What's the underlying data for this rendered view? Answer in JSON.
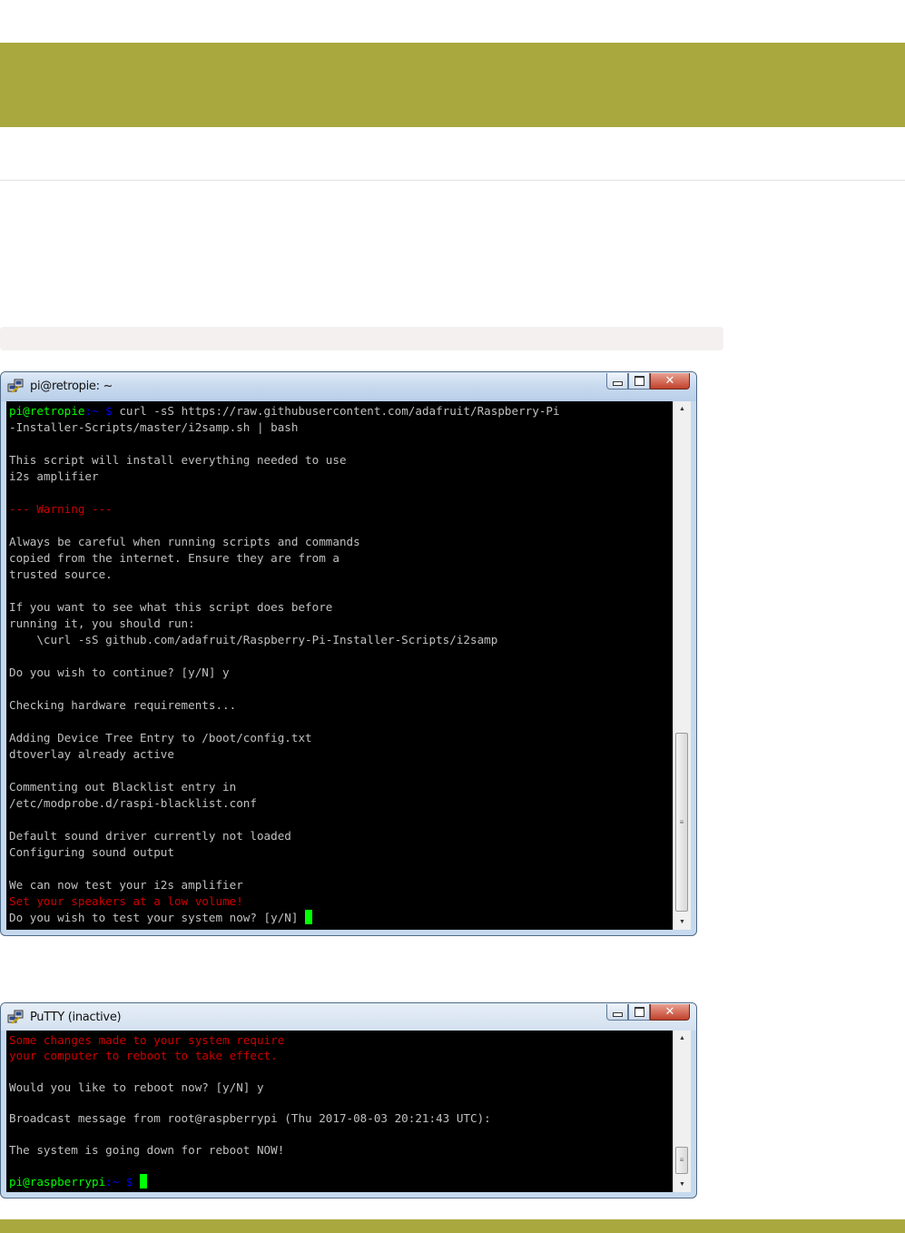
{
  "window1": {
    "title": "pi@retropie: ~",
    "lines": [
      [
        {
          "t": "pi@retropie",
          "c": "g"
        },
        {
          "t": ":~ $ ",
          "c": "b"
        },
        {
          "t": "curl -sS https://raw.githubusercontent.com/adafruit/Raspberry-Pi"
        }
      ],
      [
        {
          "t": "-Installer-Scripts/master/i2samp.sh | bash"
        }
      ],
      [],
      [
        {
          "t": "This script will install everything needed to use"
        }
      ],
      [
        {
          "t": "i2s amplifier"
        }
      ],
      [],
      [
        {
          "t": "--- Warning ---",
          "c": "r"
        }
      ],
      [],
      [
        {
          "t": "Always be careful when running scripts and commands"
        }
      ],
      [
        {
          "t": "copied from the internet. Ensure they are from a"
        }
      ],
      [
        {
          "t": "trusted source."
        }
      ],
      [],
      [
        {
          "t": "If you want to see what this script does before"
        }
      ],
      [
        {
          "t": "running it, you should run:"
        }
      ],
      [
        {
          "t": "    \\curl -sS github.com/adafruit/Raspberry-Pi-Installer-Scripts/i2samp"
        }
      ],
      [],
      [
        {
          "t": "Do you wish to continue? [y/N] y"
        }
      ],
      [],
      [
        {
          "t": "Checking hardware requirements..."
        }
      ],
      [],
      [
        {
          "t": "Adding Device Tree Entry to /boot/config.txt"
        }
      ],
      [
        {
          "t": "dtoverlay already active"
        }
      ],
      [],
      [
        {
          "t": "Commenting out Blacklist entry in"
        }
      ],
      [
        {
          "t": "/etc/modprobe.d/raspi-blacklist.conf"
        }
      ],
      [],
      [
        {
          "t": "Default sound driver currently not loaded"
        }
      ],
      [
        {
          "t": "Configuring sound output"
        }
      ],
      [],
      [
        {
          "t": "We can now test your i2s amplifier"
        }
      ],
      [
        {
          "t": "Set your speakers at a low volume!",
          "c": "r"
        }
      ],
      [
        {
          "t": "Do you wish to test your system now? [y/N] "
        },
        {
          "cursor": true
        }
      ]
    ]
  },
  "window2": {
    "title": "PuTTY (inactive)",
    "lines": [
      [
        {
          "t": "Some changes made to your system require",
          "c": "r"
        }
      ],
      [
        {
          "t": "your computer to reboot to take effect.",
          "c": "r"
        }
      ],
      [],
      [
        {
          "t": "Would you like to reboot now? [y/N] y"
        }
      ],
      [],
      [
        {
          "t": "Broadcast message from root@raspberrypi (Thu 2017-08-03 20:21:43 UTC):"
        }
      ],
      [],
      [
        {
          "t": "The system is going down for reboot NOW!"
        }
      ],
      [],
      [
        {
          "t": "pi@raspberrypi",
          "c": "g"
        },
        {
          "t": ":~ $ ",
          "c": "b"
        },
        {
          "cursor": true
        }
      ]
    ]
  },
  "icons": {
    "app": "putty-icon",
    "minimize": "minimize-icon",
    "maximize": "maximize-icon",
    "close": "close-icon",
    "scroll_up": "scroll-up-arrow-icon",
    "scroll_down": "scroll-down-arrow-icon"
  },
  "colors": {
    "accent_band": "#a9a83e",
    "terminal_bg": "#000000",
    "terminal_text": "#c0c0c0",
    "prompt_user": "#00ff00",
    "prompt_path": "#0000ff",
    "warning_text": "#cc0000",
    "cursor": "#00ff00"
  }
}
